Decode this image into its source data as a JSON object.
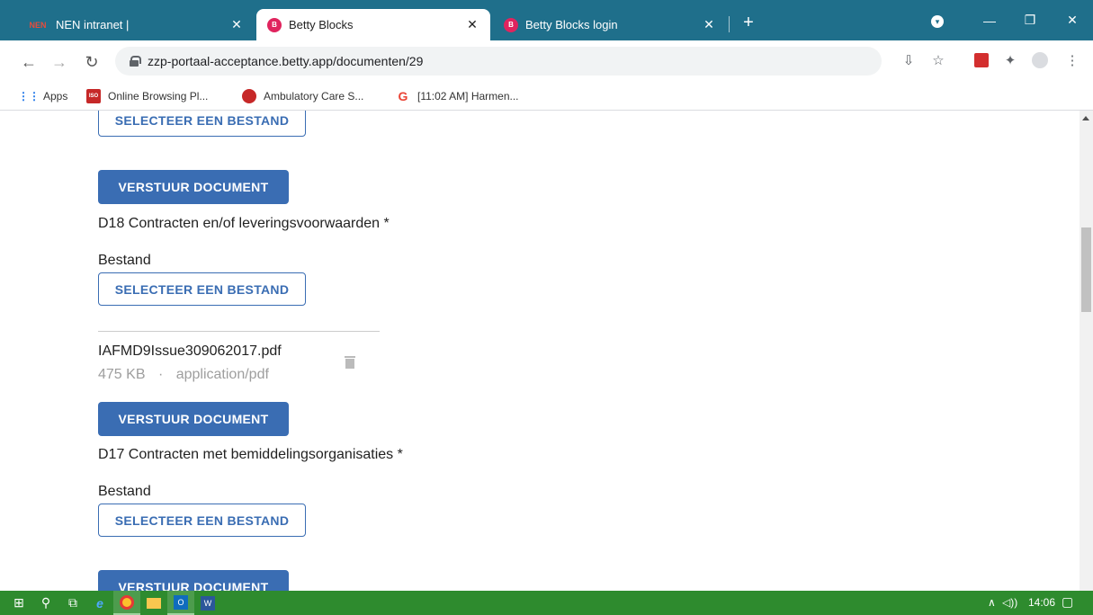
{
  "browser": {
    "tabs": [
      {
        "favicon": "NEN",
        "title": "NEN intranet |",
        "close": "✕"
      },
      {
        "favicon": "B",
        "title": "Betty Blocks",
        "close": "✕"
      },
      {
        "favicon": "B",
        "title": "Betty Blocks login",
        "close": "✕"
      }
    ],
    "new_tab": "+",
    "url": "zzp-portaal-acceptance.betty.app/documenten/29",
    "bookmarks": [
      {
        "icon": "apps-icon",
        "label": "Apps"
      },
      {
        "icon": "ISO",
        "label": "Online Browsing Pl..."
      },
      {
        "icon": "ambulatory-icon",
        "label": "Ambulatory Care S..."
      },
      {
        "icon": "G",
        "label": "[11:02 AM] Harmen..."
      }
    ]
  },
  "page": {
    "select_file_label": "SELECTEER EEN BESTAND",
    "submit_label": "VERSTUUR DOCUMENT",
    "sections": [
      {
        "title": "D18 Contracten en/of leveringsvoorwaarden *",
        "field_label": "Bestand"
      },
      {
        "title": "D17 Contracten met bemiddelingsorganisaties *",
        "field_label": "Bestand"
      }
    ],
    "uploaded_file": {
      "name": "IAFMD9Issue309062017.pdf",
      "size": "475 KB",
      "separator": "·",
      "type": "application/pdf"
    }
  },
  "taskbar": {
    "time": "14:06",
    "tray_up": "∧",
    "volume": "🔊"
  }
}
